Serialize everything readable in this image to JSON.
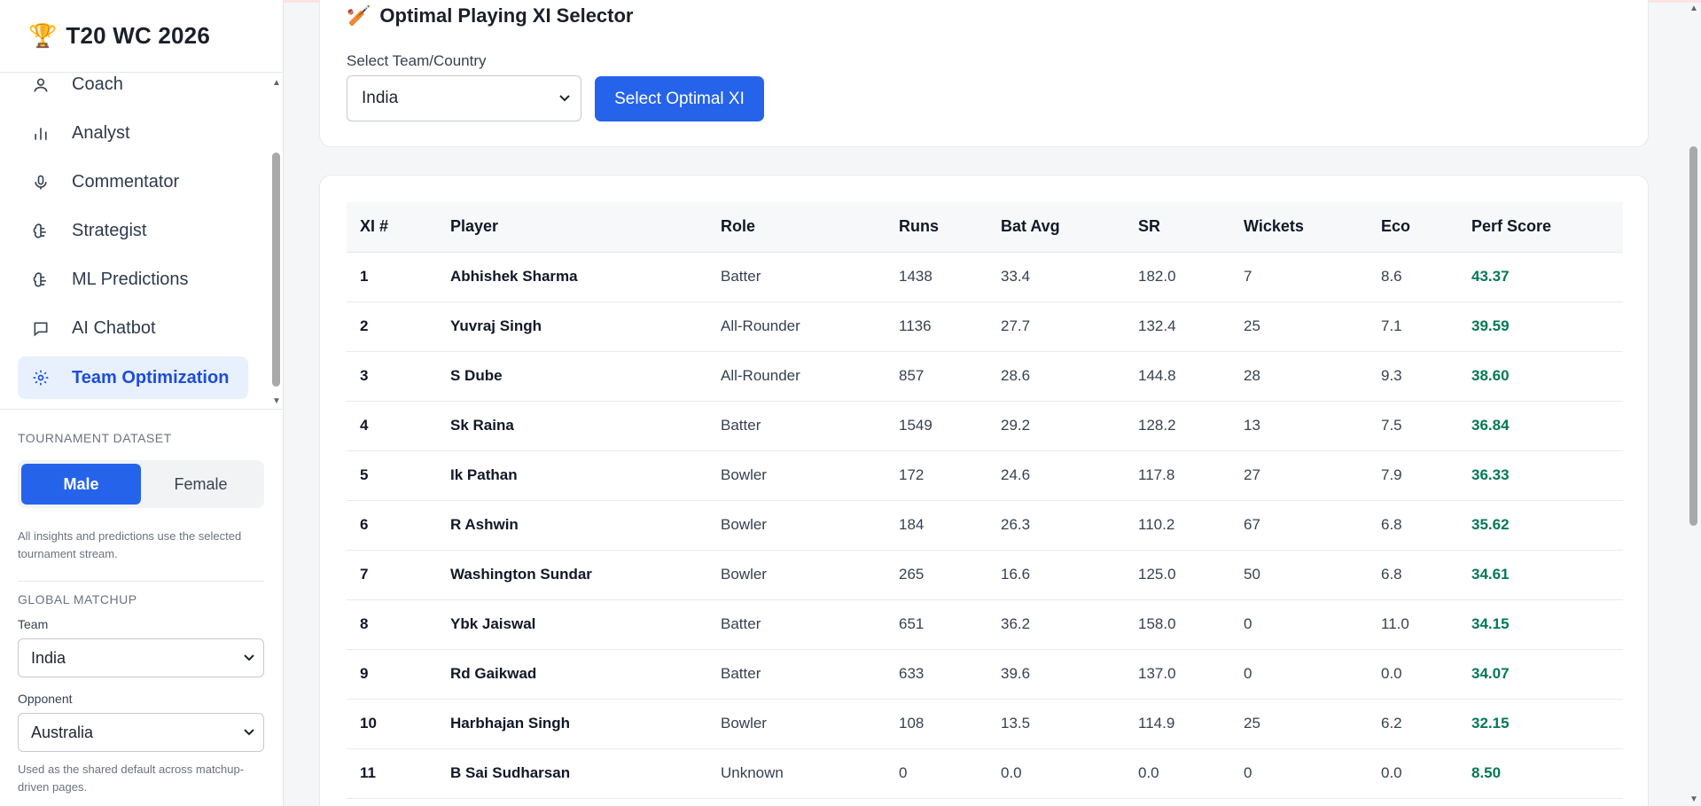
{
  "app": {
    "title": "T20 WC 2026",
    "icon": "trophy-icon"
  },
  "sidebar": {
    "nav": [
      {
        "label": "Coach",
        "icon": "user-icon",
        "active": false
      },
      {
        "label": "Analyst",
        "icon": "bar-chart-icon",
        "active": false
      },
      {
        "label": "Commentator",
        "icon": "microphone-icon",
        "active": false
      },
      {
        "label": "Strategist",
        "icon": "brain-icon",
        "active": false
      },
      {
        "label": "ML Predictions",
        "icon": "brain-icon",
        "active": false
      },
      {
        "label": "AI Chatbot",
        "icon": "chat-icon",
        "active": false
      },
      {
        "label": "Team Optimization",
        "icon": "gear-icon",
        "active": true
      }
    ],
    "dataset": {
      "label": "TOURNAMENT DATASET",
      "options": [
        "Male",
        "Female"
      ],
      "selected": "Male",
      "note": "All insights and predictions use the selected tournament stream."
    },
    "matchup": {
      "label": "GLOBAL MATCHUP",
      "team_label": "Team",
      "team_value": "India",
      "opponent_label": "Opponent",
      "opponent_value": "Australia",
      "note": "Used as the shared default across matchup-driven pages."
    }
  },
  "selector": {
    "title": "Optimal Playing XI Selector",
    "icon": "cricket-bat-icon",
    "select_label": "Select Team/Country",
    "select_value": "India",
    "button_label": "Select Optimal XI"
  },
  "table": {
    "headers": [
      "XI #",
      "Player",
      "Role",
      "Runs",
      "Bat Avg",
      "SR",
      "Wickets",
      "Eco",
      "Perf Score"
    ],
    "rows": [
      [
        "1",
        "Abhishek Sharma",
        "Batter",
        "1438",
        "33.4",
        "182.0",
        "7",
        "8.6",
        "43.37"
      ],
      [
        "2",
        "Yuvraj Singh",
        "All-Rounder",
        "1136",
        "27.7",
        "132.4",
        "25",
        "7.1",
        "39.59"
      ],
      [
        "3",
        "S Dube",
        "All-Rounder",
        "857",
        "28.6",
        "144.8",
        "28",
        "9.3",
        "38.60"
      ],
      [
        "4",
        "Sk Raina",
        "Batter",
        "1549",
        "29.2",
        "128.2",
        "13",
        "7.5",
        "36.84"
      ],
      [
        "5",
        "Ik Pathan",
        "Bowler",
        "172",
        "24.6",
        "117.8",
        "27",
        "7.9",
        "36.33"
      ],
      [
        "6",
        "R Ashwin",
        "Bowler",
        "184",
        "26.3",
        "110.2",
        "67",
        "6.8",
        "35.62"
      ],
      [
        "7",
        "Washington Sundar",
        "Bowler",
        "265",
        "16.6",
        "125.0",
        "50",
        "6.8",
        "34.61"
      ],
      [
        "8",
        "Ybk Jaiswal",
        "Batter",
        "651",
        "36.2",
        "158.0",
        "0",
        "11.0",
        "34.15"
      ],
      [
        "9",
        "Rd Gaikwad",
        "Batter",
        "633",
        "39.6",
        "137.0",
        "0",
        "0.0",
        "34.07"
      ],
      [
        "10",
        "Harbhajan Singh",
        "Bowler",
        "108",
        "13.5",
        "114.9",
        "25",
        "6.2",
        "32.15"
      ],
      [
        "11",
        "B Sai Sudharsan",
        "Unknown",
        "0",
        "0.0",
        "0.0",
        "0",
        "0.0",
        "8.50"
      ]
    ]
  },
  "colors": {
    "accent": "#2563eb",
    "score": "#047857",
    "active_bg": "#e8f0fe"
  }
}
